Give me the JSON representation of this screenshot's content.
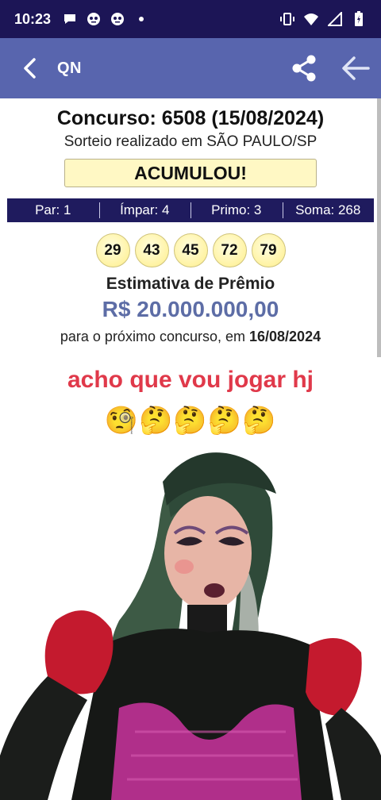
{
  "status_bar": {
    "time": "10:23",
    "left_icons": [
      "chat-icon",
      "emoji-icon",
      "emoji-icon",
      "dot-icon"
    ],
    "right_icons": [
      "vibrate-icon",
      "wifi-icon",
      "signal-icon",
      "battery-icon"
    ]
  },
  "app_bar": {
    "title": "QN",
    "background": "#5865ae"
  },
  "result": {
    "contest": "Concurso: 6508 (15/08/2024)",
    "location": "Sorteio realizado em SÃO PAULO/SP",
    "status_badge": "ACUMULOU!",
    "stats": [
      "Par: 1",
      "Ímpar: 4",
      "Primo: 3",
      "Soma: 268"
    ],
    "numbers": [
      "29",
      "43",
      "45",
      "72",
      "79"
    ],
    "estimate_label": "Estimativa de Prêmio",
    "estimate_value": "R$ 20.000.000,00",
    "next_prefix": "para o próximo concurso, em ",
    "next_date": "16/08/2024"
  },
  "meme": {
    "caption": "acho que vou jogar hj",
    "emojis": "🧐🤔🤔🤔🤔"
  },
  "colors": {
    "status_bar": "#1c1556",
    "stats_bar": "#1f1b5e",
    "prize": "#5d6da6",
    "caption": "#e0394a"
  }
}
